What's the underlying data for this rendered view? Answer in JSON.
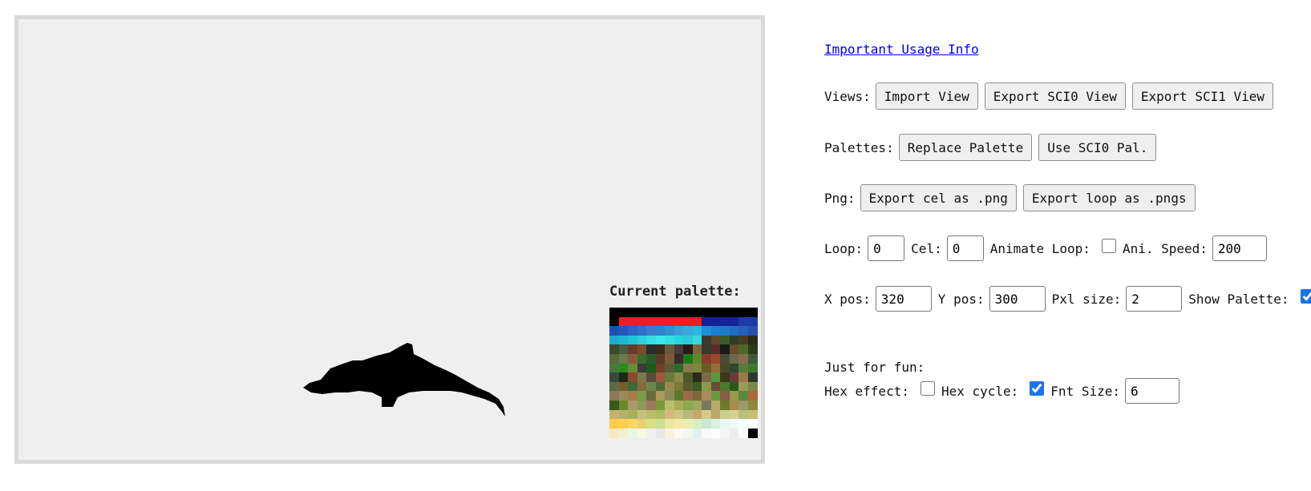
{
  "canvas": {
    "palette_label": "Current palette:",
    "palette_colors": [
      "#000000",
      "#000000",
      "#000000",
      "#000000",
      "#000000",
      "#000000",
      "#000000",
      "#000000",
      "#000000",
      "#000000",
      "#000000",
      "#000000",
      "#000000",
      "#000000",
      "#000000",
      "#000000",
      "#000000",
      "#ee1c24",
      "#ee1c24",
      "#ee1c24",
      "#ee1c24",
      "#ee1c24",
      "#ee1c24",
      "#ee1c24",
      "#ee1c24",
      "#ee1c24",
      "#15229a",
      "#15229a",
      "#15229a",
      "#15229a",
      "#1f3aa8",
      "#1f3aa8",
      "#1f4fb5",
      "#2357bb",
      "#2d63c2",
      "#3070c8",
      "#3a7dcc",
      "#2d84cf",
      "#3092d4",
      "#39a0d8",
      "#3ba8dc",
      "#2ab8e0",
      "#1f8fd6",
      "#1a7fd0",
      "#1c78c9",
      "#1e6ec2",
      "#2460ba",
      "#264fb0",
      "#1caccd",
      "#1cb8d3",
      "#1ec4d8",
      "#2cd0de",
      "#36dce4",
      "#3ce6e9",
      "#35e0e4",
      "#2ad6dd",
      "#2dc9d4",
      "#36d9dd",
      "#3a3a30",
      "#5a4a2a",
      "#3c5a2a",
      "#2a3c2a",
      "#4a3a20",
      "#2a2a1a",
      "#3a4a2a",
      "#4a5a3a",
      "#6a3a2a",
      "#7a4a2a",
      "#2a2a2a",
      "#3a2a1a",
      "#6a5a3a",
      "#4a3a3a",
      "#2a1a1a",
      "#7a6a3a",
      "#3a3a2a",
      "#5a2a2a",
      "#1a1a1a",
      "#6a4a2a",
      "#4a6a2a",
      "#2a3a1a",
      "#5a6a3a",
      "#6a7a4a",
      "#8a5a3a",
      "#3a6a2a",
      "#2a5a2a",
      "#5a3a2a",
      "#7a5a3a",
      "#3a2a2a",
      "#1a7a1a",
      "#5a8a2a",
      "#8a3a2a",
      "#9a4a2a",
      "#4a4a3a",
      "#6a6a4a",
      "#8a6a4a",
      "#3a5a3a",
      "#4a7a3a",
      "#2a8a1a",
      "#6a8a3a",
      "#3a3a3a",
      "#1a5a1a",
      "#7a3a2a",
      "#5a5a3a",
      "#2a6a2a",
      "#8a7a4a",
      "#7a8a3a",
      "#6a5a2a",
      "#9a6a3a",
      "#4a4a2a",
      "#2a4a2a",
      "#5a7a3a",
      "#3a7a2a",
      "#3a4a3a",
      "#1a2a1a",
      "#8a4a2a",
      "#7a7a4a",
      "#5a4a3a",
      "#9a5a3a",
      "#6a7a3a",
      "#8a8a4a",
      "#4a5a2a",
      "#2a2a1a",
      "#7a6a4a",
      "#5a9a3a",
      "#3a3a1a",
      "#6a3a3a",
      "#9a7a4a",
      "#2a3a2a",
      "#5a6a4a",
      "#7a5a2a",
      "#3a6a3a",
      "#8a6a3a",
      "#6a8a4a",
      "#4a6a3a",
      "#9a8a4a",
      "#7a7a3a",
      "#5a5a2a",
      "#3a5a2a",
      "#8a9a4a",
      "#6a4a3a",
      "#4a7a2a",
      "#2a5a1a",
      "#9a9a5a",
      "#7a8a4a",
      "#8a7a5a",
      "#9a8a5a",
      "#aa7a4a",
      "#7a9a4a",
      "#6a6a3a",
      "#aa9a5a",
      "#8a8a5a",
      "#5a7a2a",
      "#9a6a4a",
      "#7a6a3a",
      "#aa8a5a",
      "#6a9a3a",
      "#8a5a4a",
      "#9a9a4a",
      "#5a8a3a",
      "#aa6a3a",
      "#3a5a1a",
      "#6a8a2a",
      "#aa9a6a",
      "#8a9a5a",
      "#9a7a5a",
      "#7a9a3a",
      "#babe6a",
      "#aaaa5a",
      "#8aaa4a",
      "#9aaa5a",
      "#7a7a5a",
      "#baaa6a",
      "#6a7a2a",
      "#aa8a4a",
      "#9a9a6a",
      "#8a8a3a",
      "#c8b070",
      "#b8b06a",
      "#a8b05a",
      "#c8c07a",
      "#b8c06a",
      "#a8c060",
      "#d8b87a",
      "#c8c880",
      "#b8b87a",
      "#c8a86a",
      "#d8c88a",
      "#b8a86a",
      "#c8d08a",
      "#d8d090",
      "#b8c07a",
      "#c8c070",
      "#ffcc44",
      "#ffd050",
      "#ffd860",
      "#e8d070",
      "#d8e080",
      "#c8e090",
      "#e8e8a0",
      "#f8e8a8",
      "#e8f0b0",
      "#d8f0c0",
      "#c8e8d0",
      "#d8f0e0",
      "#e8f8f0",
      "#f0f8f8",
      "#f8fcfc",
      "#ffffff",
      "#f8e8c0",
      "#f0f0d0",
      "#e8f8e0",
      "#f8f8e8",
      "#f0f0f0",
      "#e8e8e8",
      "#f8f0e0",
      "#fff8f0",
      "#f0f8f0",
      "#e0f0f0",
      "#f8f8f8",
      "#fcfcfc",
      "#f4f4f4",
      "#ececec",
      "#fafafa",
      "#000000"
    ]
  },
  "panel": {
    "usage_link": "Important Usage Info",
    "views_label": "Views:",
    "import_view": "Import View",
    "export_sci0_view": "Export SCI0 View",
    "export_sci1_view": "Export SCI1 View",
    "palettes_label": "Palettes:",
    "replace_palette": "Replace Palette",
    "use_sci0_pal": "Use SCI0 Pal.",
    "png_label": "Png:",
    "export_cel_png": "Export cel as .png",
    "export_loop_pngs": "Export loop as .pngs",
    "loop_label": "Loop:",
    "loop_value": "0",
    "cel_label": "Cel:",
    "cel_value": "0",
    "animate_loop_label": "Animate Loop:",
    "animate_loop_checked": false,
    "ani_speed_label": "Ani. Speed:",
    "ani_speed_value": "200",
    "xpos_label": "X pos:",
    "xpos_value": "320",
    "ypos_label": "Y pos:",
    "ypos_value": "300",
    "pxl_size_label": "Pxl size:",
    "pxl_size_value": "2",
    "show_palette_label": "Show Palette:",
    "show_palette_checked": true,
    "fun_label": "Just for fun:",
    "hex_effect_label": "Hex effect:",
    "hex_effect_checked": false,
    "hex_cycle_label": "Hex cycle:",
    "hex_cycle_checked": true,
    "fnt_size_label": "Fnt Size:",
    "fnt_size_value": "6"
  }
}
